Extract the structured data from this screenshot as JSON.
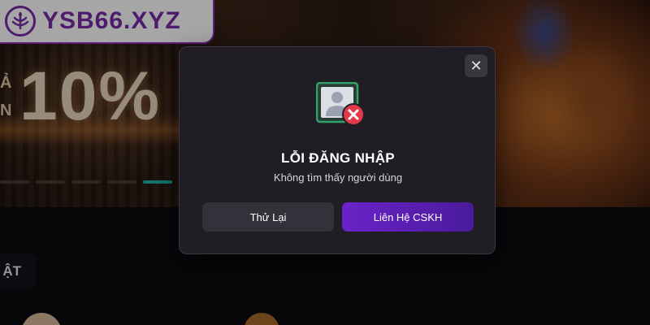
{
  "header": {
    "logo_text": "YSB66.XYZ",
    "logo_icon": "brand-emblem-icon"
  },
  "banner": {
    "promo_prefix": "Ả\nN",
    "promo_value": "10%",
    "slider_dots": 5,
    "active_dot": 4
  },
  "section": {
    "label": "ẬT"
  },
  "dialog": {
    "title": "LỖI ĐĂNG NHẬP",
    "message": "Không tìm thấy người dùng",
    "close_icon": "close-icon",
    "status_icon": "user-error-icon",
    "retry_label": "Thử Lại",
    "contact_label": "Liên Hệ CSKH"
  },
  "colors": {
    "accent_purple": "#6b22c9",
    "error_red": "#e23a4a",
    "icon_green": "#2ea36a",
    "slider_active": "#1fb5a0",
    "modal_bg": "#211d24"
  }
}
